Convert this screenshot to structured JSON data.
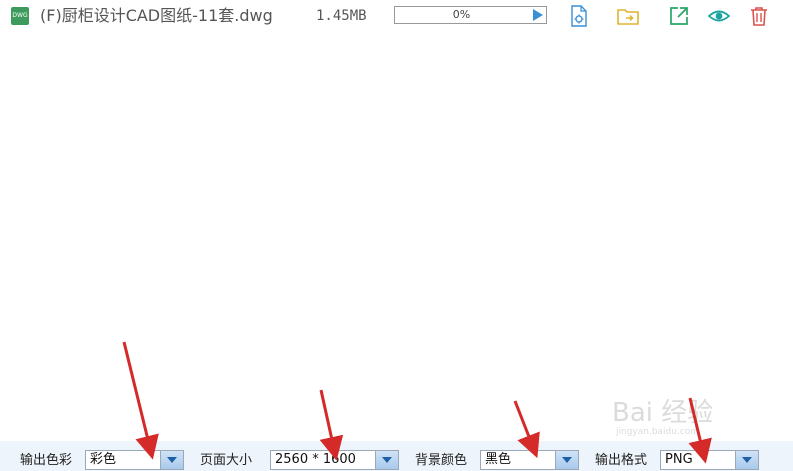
{
  "file": {
    "type_badge": "DWG",
    "name": "(F)厨柜设计CAD图纸-11套.dwg",
    "size": "1.45MB",
    "progress_percent": 0,
    "progress_text": "0%"
  },
  "actions": [
    {
      "icon": "file-settings-icon",
      "color": "#3a8fd6"
    },
    {
      "icon": "folder-icon",
      "color": "#e0b431"
    },
    {
      "icon": "share-icon",
      "color": "#27a765"
    },
    {
      "icon": "eye-icon",
      "color": "#1aa3a0"
    },
    {
      "icon": "trash-icon",
      "color": "#d9534f"
    }
  ],
  "options": {
    "color_label": "输出色彩",
    "color_value": "彩色",
    "page_size_label": "页面大小",
    "page_size_value": "2560 * 1600",
    "background_label": "背景颜色",
    "background_value": "黑色",
    "format_label": "输出格式",
    "format_value": "PNG"
  },
  "colors": {
    "annotation_arrow": "#d42a2a",
    "options_bar_bg": "#eef4fb",
    "dropdown_accent": "#1f5fa8"
  },
  "watermark": {
    "main": "Bai 经验",
    "sub": "jingyan.baidu.com"
  }
}
